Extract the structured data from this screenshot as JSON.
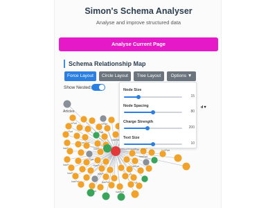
{
  "app": {
    "title": "Simon's Schema Analyser",
    "subtitle": "Analyse and improve structured data"
  },
  "actions": {
    "analyse_label": "Analyse Current Page"
  },
  "map": {
    "section_title": "Schema Relationship Map",
    "layout_buttons": [
      {
        "label": "Force Layout",
        "active": true
      },
      {
        "label": "Circle Layout",
        "active": false
      },
      {
        "label": "Tree Layout",
        "active": false
      }
    ],
    "options_label": "Options ▼",
    "show_nested_label": "Show Nested:",
    "show_nested_on": true,
    "options": [
      {
        "label": "Node Size",
        "value": "15",
        "fraction": 0.25
      },
      {
        "label": "Node Spacing",
        "value": "80",
        "fraction": 0.5
      },
      {
        "label": "Charge Strength",
        "value": "200",
        "fraction": 0.4
      },
      {
        "label": "Text Size",
        "value": "10",
        "fraction": 0.5
      }
    ],
    "dropdown_glyph": "d▼",
    "node_labels": {
      "articles": "Articles",
      "small": "hasPart"
    },
    "colors": {
      "accent": "#2a7fe0",
      "magenta": "#e619c9",
      "node_orange": "#f0a22a",
      "node_gray": "#8a9097",
      "node_green": "#3aa55a",
      "node_red": "#e23a3a"
    }
  }
}
